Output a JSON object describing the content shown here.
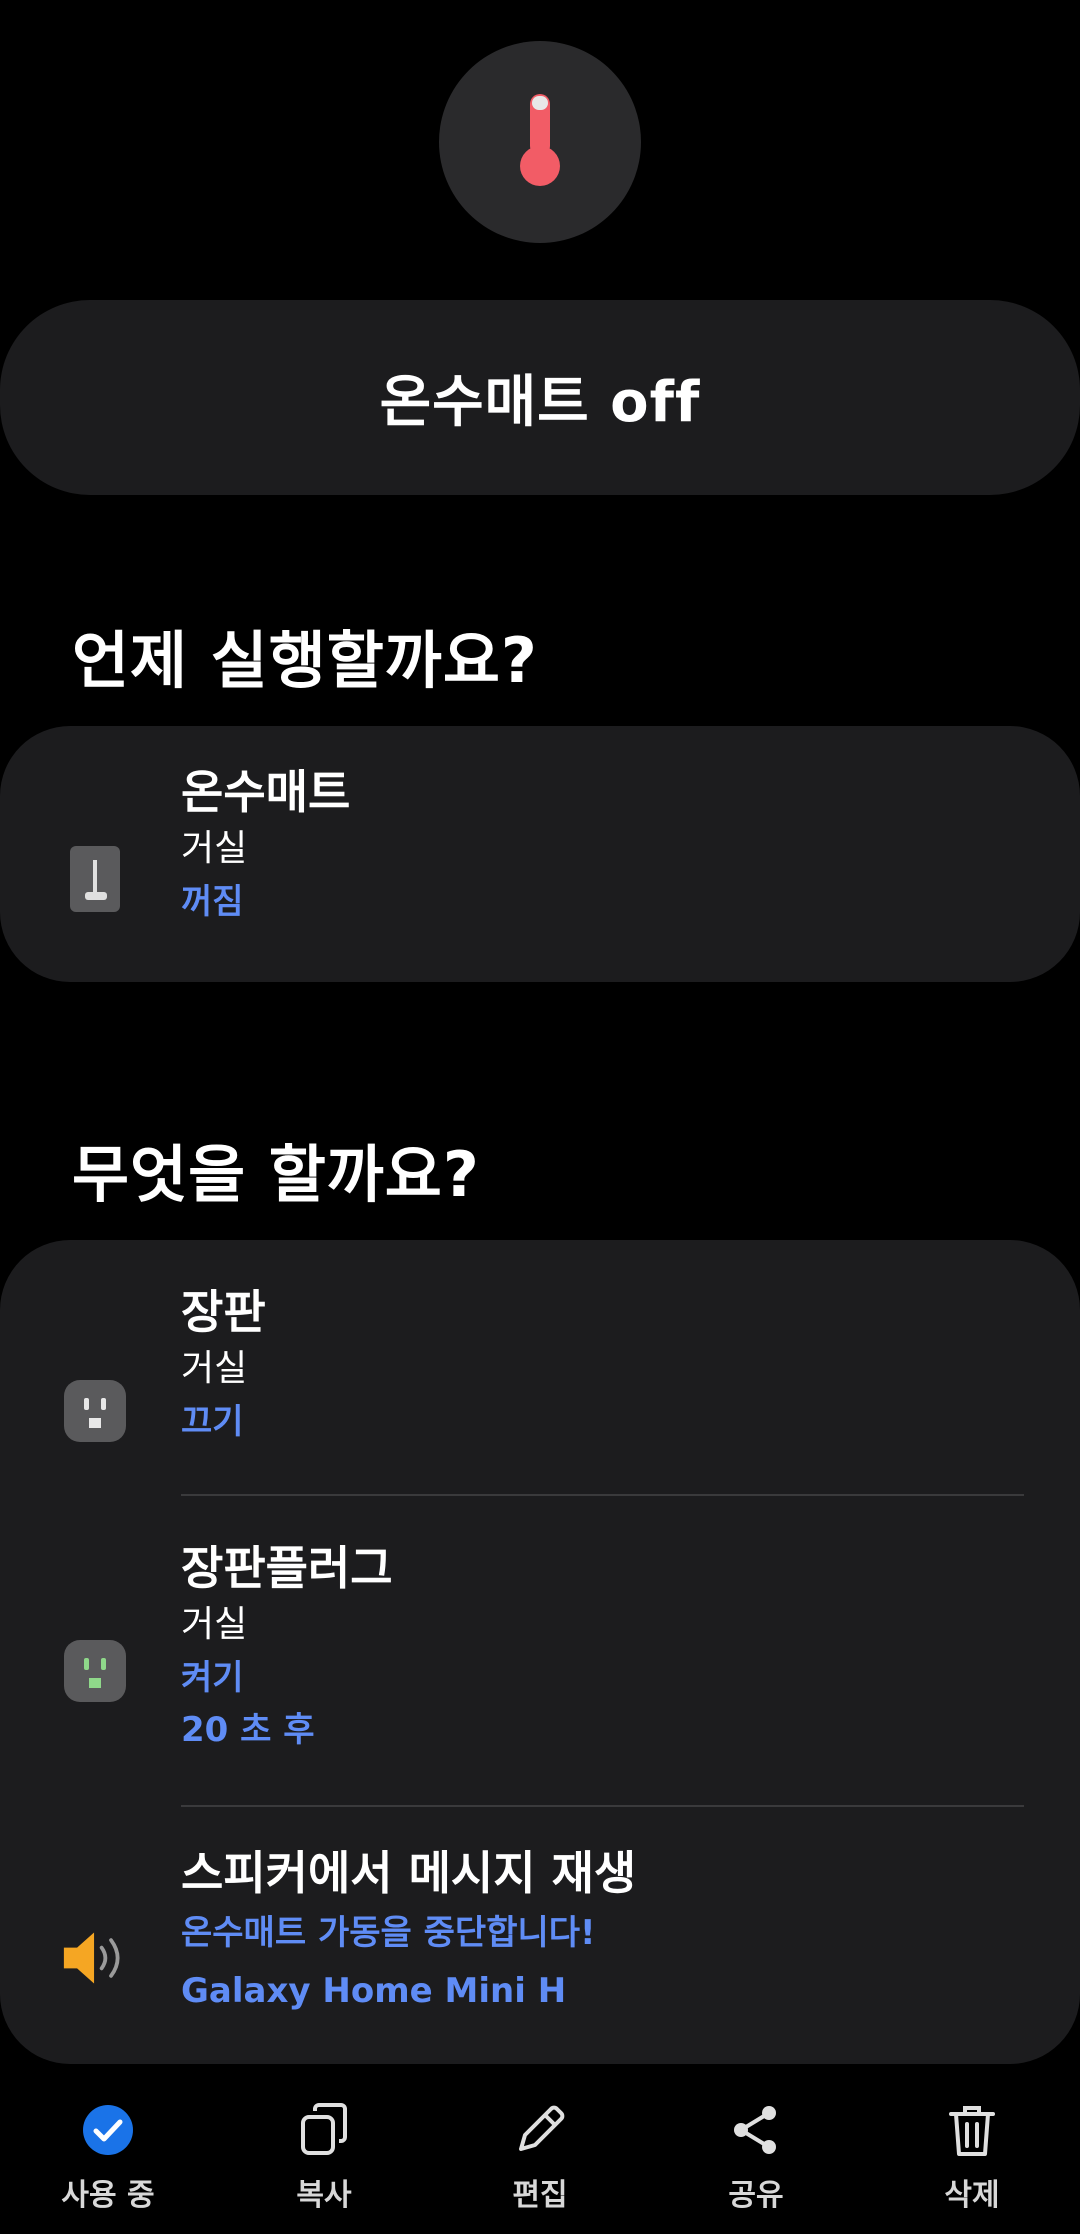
{
  "hero": {
    "icon": "thermometer-icon",
    "accent": "#f25c66"
  },
  "title": "온수매트 off",
  "when": {
    "heading": "언제 실행할까요?",
    "condition": {
      "icon": "switch-icon",
      "name": "온수매트",
      "room": "거실",
      "state": "꺼짐"
    }
  },
  "what": {
    "heading": "무엇을 할까요?",
    "actions": [
      {
        "icon": "plug-icon",
        "name": "장판",
        "room": "거실",
        "action": "끄기"
      },
      {
        "icon": "plug-green-icon",
        "name": "장판플러그",
        "room": "거실",
        "action": "켜기",
        "delay": "20 초 후"
      },
      {
        "icon": "speaker-icon",
        "name": "스피커에서 메시지 재생",
        "message": "온수매트 가동을 중단합니다!",
        "device": "Galaxy Home Mini H"
      }
    ]
  },
  "nav": {
    "items": [
      {
        "icon": "check-circle-icon",
        "label": "사용 중"
      },
      {
        "icon": "copy-icon",
        "label": "복사"
      },
      {
        "icon": "pencil-icon",
        "label": "편집"
      },
      {
        "icon": "share-icon",
        "label": "공유"
      },
      {
        "icon": "trash-icon",
        "label": "삭제"
      }
    ]
  },
  "colors": {
    "link": "#5f8cf5",
    "card": "#1c1c1e",
    "active": "#1a73e8",
    "speaker": "#f5a623",
    "plugOn": "#8fd88a"
  }
}
